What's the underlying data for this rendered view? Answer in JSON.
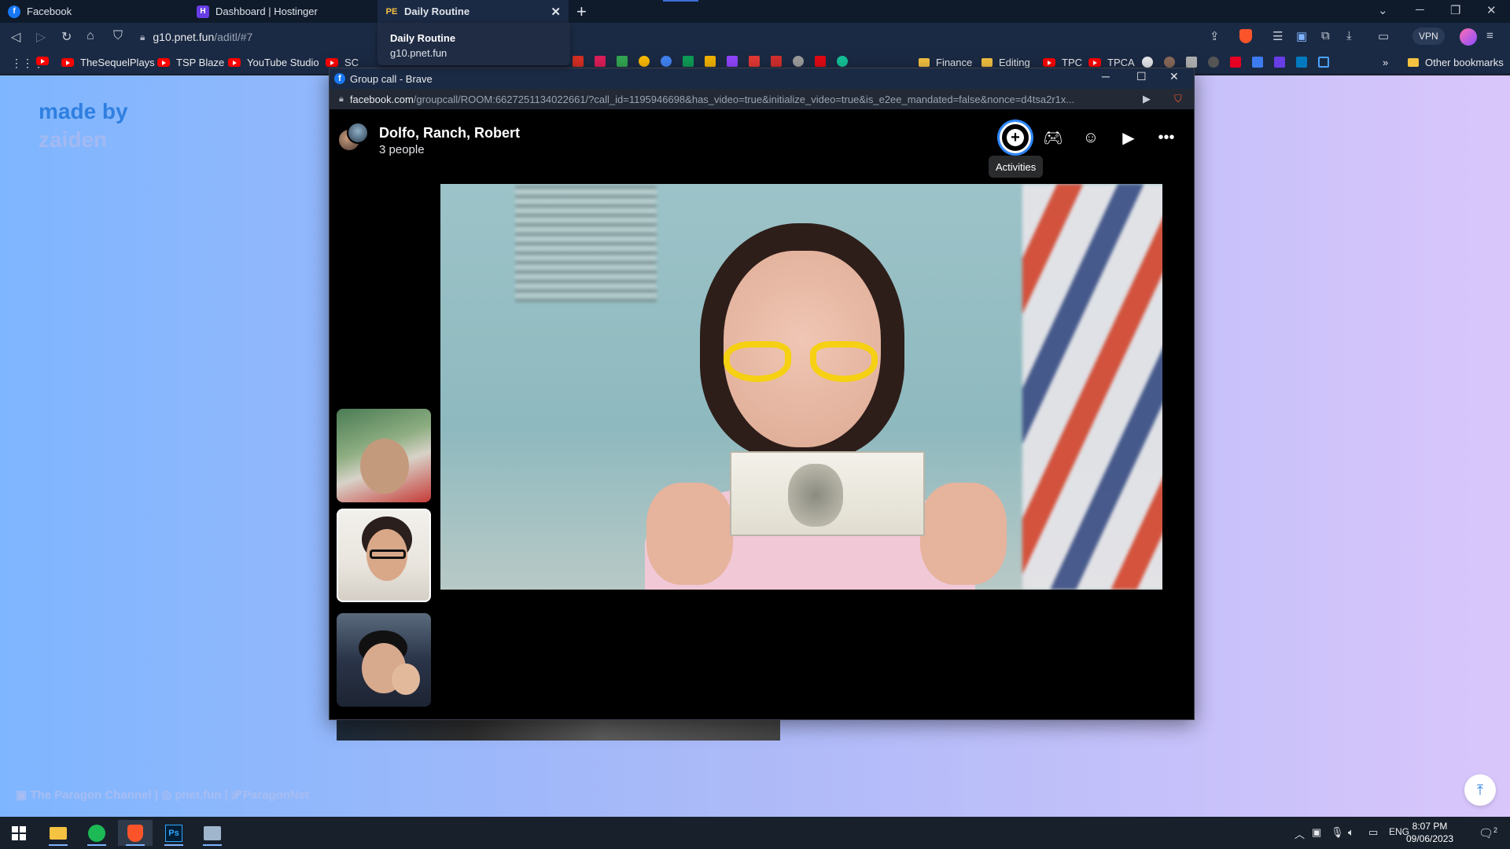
{
  "browser": {
    "tabs": [
      {
        "title": "Facebook",
        "active": false
      },
      {
        "title": "Dashboard | Hostinger",
        "active": false
      },
      {
        "title": "Daily Routine",
        "active": true
      }
    ],
    "tab_tooltip": {
      "title": "Daily Routine",
      "domain": "g10.pnet.fun"
    },
    "address": {
      "host": "g10.pnet.fun",
      "path": "/aditl/#7"
    },
    "vpn_label": "VPN",
    "bookmarks": [
      {
        "label": "TheSequelPlays",
        "icon": "youtube-icon"
      },
      {
        "label": "TSP Blaze",
        "icon": "youtube-icon"
      },
      {
        "label": "YouTube Studio",
        "icon": "youtube-icon"
      },
      {
        "label": "SC",
        "icon": "youtube-icon"
      },
      {
        "label": "Finance",
        "icon": "folder-icon"
      },
      {
        "label": "Editing",
        "icon": "folder-icon"
      },
      {
        "label": "TPC",
        "icon": "youtube-icon"
      },
      {
        "label": "TPCA",
        "icon": "youtube-icon"
      }
    ],
    "other_bookmarks": "Other bookmarks",
    "more_bookmarks": "»"
  },
  "page": {
    "made_by": "made by",
    "author": "zaiden",
    "footer": "▣ The Paragon Channel | ◎ pnet.fun | 𝓟 ParagonNet",
    "scroll_top_icon": "scroll-to-top-icon"
  },
  "popup": {
    "window_title": "Group call - Brave",
    "url_host": "facebook.com",
    "url_path": "/groupcall/ROOM:6627251134022661/?call_id=1195946698&has_video=true&initialize_video=true&is_e2ee_mandated=false&nonce=d4tsa2r1x...",
    "call": {
      "title": "Dolfo, Ranch, Robert",
      "subtitle": "3 people",
      "tooltip": "Activities",
      "controls": [
        "activities-icon",
        "games-icon",
        "effects-icon",
        "watch-together-icon",
        "more-icon"
      ],
      "participants_count": 3
    }
  },
  "taskbar": {
    "apps": [
      "file-explorer-icon",
      "spotify-icon",
      "brave-icon",
      "photoshop-icon",
      "remote-app-icon"
    ],
    "language": "ENG",
    "time": "8:07 PM",
    "date": "09/06/2023",
    "notifications": "2"
  }
}
